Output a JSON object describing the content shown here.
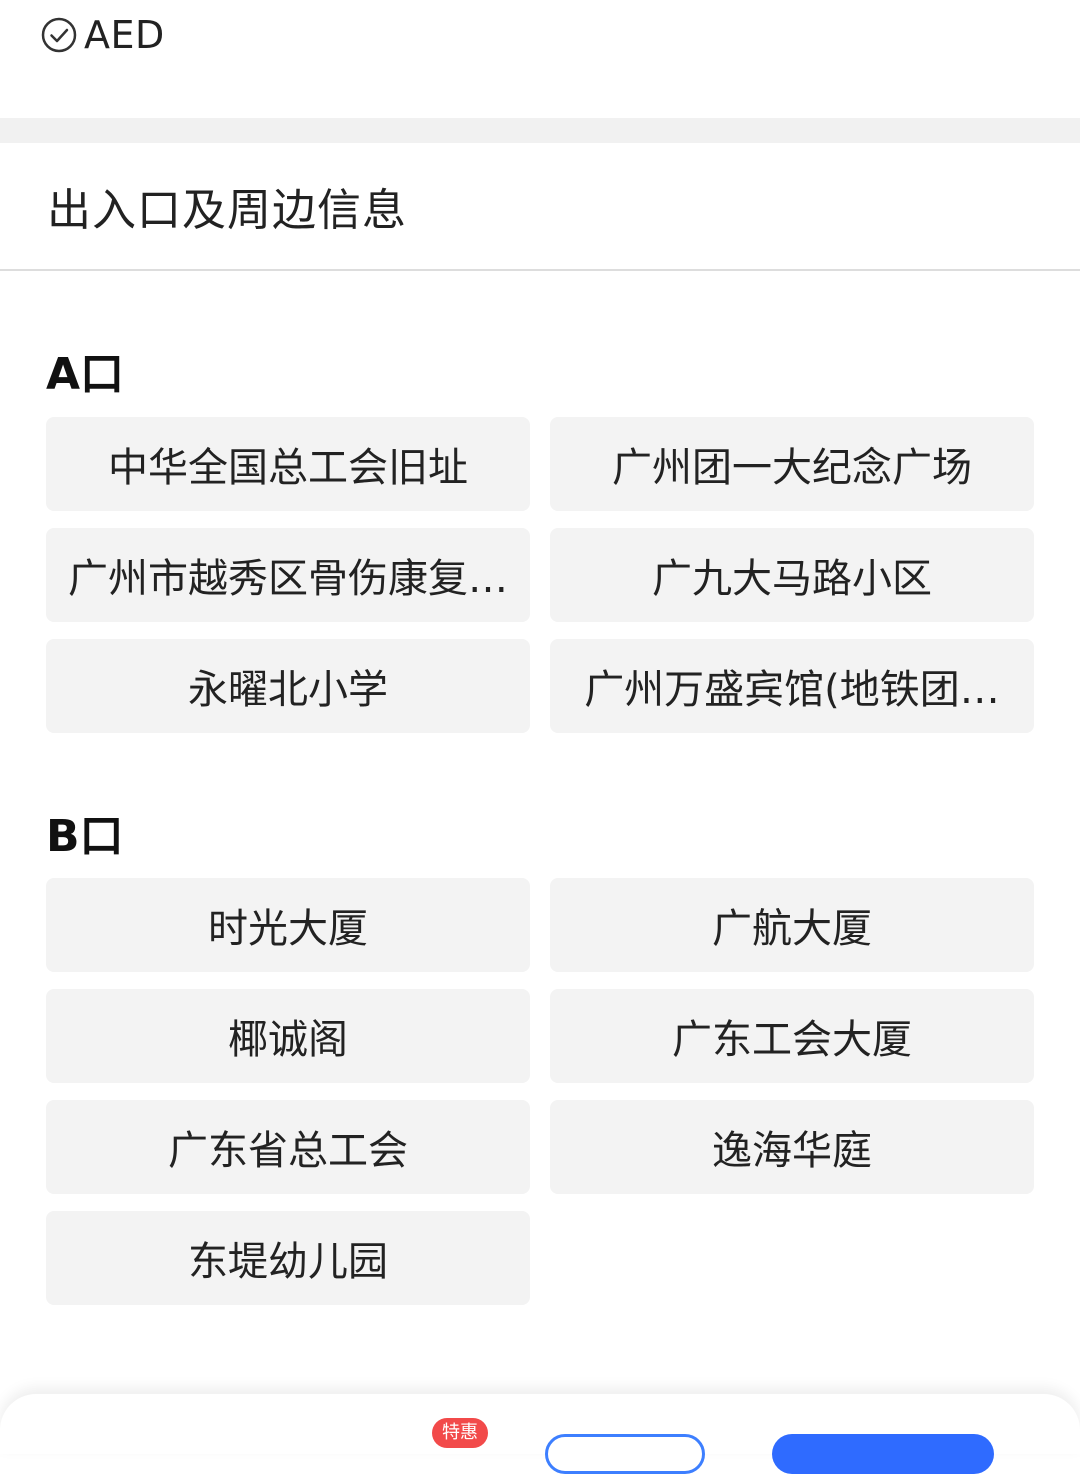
{
  "facility": {
    "icon": "check-circle-icon",
    "label": "AED"
  },
  "section": {
    "title": "出入口及周边信息"
  },
  "exits": [
    {
      "label": "A口",
      "places": [
        "中华全国总工会旧址",
        "广州团一大纪念广场",
        "广州市越秀区骨伤康复…",
        "广九大马路小区",
        "永曜北小学",
        "广州万盛宾馆(地铁团…"
      ]
    },
    {
      "label": "B口",
      "places": [
        "时光大厦",
        "广航大厦",
        "椰诚阁",
        "广东工会大厦",
        "广东省总工会",
        "逸海华庭",
        "东堤幼儿园"
      ]
    }
  ],
  "bottom_bar": {
    "badge": "特惠"
  },
  "colors": {
    "chip_bg": "#f3f3f3",
    "badge": "#f24a4a",
    "primary": "#2f6bff"
  }
}
